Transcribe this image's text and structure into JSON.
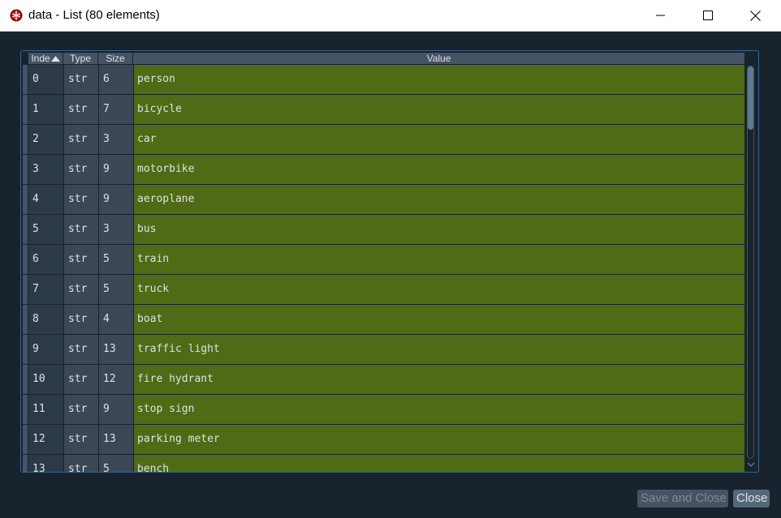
{
  "window": {
    "title": "data - List (80 elements)",
    "icon": "spyder-icon"
  },
  "table": {
    "columns": [
      "Inde",
      "Type",
      "Size",
      "Value"
    ],
    "sort_indicator": "ascending",
    "rows": [
      {
        "index": "0",
        "type": "str",
        "size": "6",
        "value": "person"
      },
      {
        "index": "1",
        "type": "str",
        "size": "7",
        "value": "bicycle"
      },
      {
        "index": "2",
        "type": "str",
        "size": "3",
        "value": "car"
      },
      {
        "index": "3",
        "type": "str",
        "size": "9",
        "value": "motorbike"
      },
      {
        "index": "4",
        "type": "str",
        "size": "9",
        "value": "aeroplane"
      },
      {
        "index": "5",
        "type": "str",
        "size": "3",
        "value": "bus"
      },
      {
        "index": "6",
        "type": "str",
        "size": "5",
        "value": "train"
      },
      {
        "index": "7",
        "type": "str",
        "size": "5",
        "value": "truck"
      },
      {
        "index": "8",
        "type": "str",
        "size": "4",
        "value": "boat"
      },
      {
        "index": "9",
        "type": "str",
        "size": "13",
        "value": "traffic light"
      },
      {
        "index": "10",
        "type": "str",
        "size": "12",
        "value": "fire hydrant"
      },
      {
        "index": "11",
        "type": "str",
        "size": "9",
        "value": "stop sign"
      },
      {
        "index": "12",
        "type": "str",
        "size": "13",
        "value": "parking meter"
      },
      {
        "index": "13",
        "type": "str",
        "size": "5",
        "value": "bench"
      }
    ]
  },
  "buttons": {
    "save_close": "Save and Close",
    "close": "Close"
  },
  "colors": {
    "background": "#19232d",
    "value_cell": "#4f6b15",
    "accent_border": "#346792"
  }
}
